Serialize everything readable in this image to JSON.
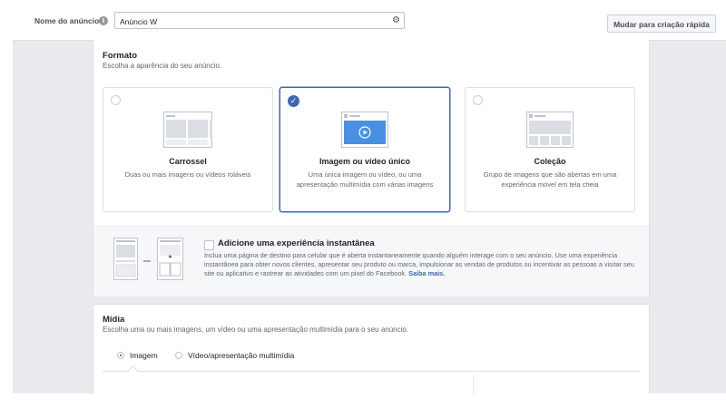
{
  "header": {
    "name_label": "Nome do anúncio",
    "name_value": "Anúncio W",
    "quick_create_label": "Mudar para criação rápida"
  },
  "format": {
    "title": "Formato",
    "subtitle": "Escolha a aparência do seu anúncio.",
    "options": [
      {
        "title": "Carrossel",
        "desc": "Duas ou mais imagens ou vídeos roláveis",
        "selected": false
      },
      {
        "title": "Imagem ou vídeo único",
        "desc": "Uma única imagem ou vídeo, ou uma apresentação multimídia com várias imagens",
        "selected": true
      },
      {
        "title": "Coleção",
        "desc": "Grupo de imagens que são abertas em uma experiência móvel em tela cheia",
        "selected": false
      }
    ],
    "instant": {
      "title": "Adicione uma experiência instantânea",
      "desc": "Inclua uma página de destino para celular que é aberta instantaneamente quando alguém interage com o seu anúncio. Use uma experiência instantânea para obter novos clientes, apresentar seu produto ou marca, impulsionar as vendas de produtos ou incentivar as pessoas a visitar seu site ou aplicativo e rastrear as atividades com um pixel do Facebook.",
      "link": "Saiba mais.",
      "checked": false
    }
  },
  "media": {
    "title": "Mídia",
    "subtitle": "Escolha uma ou mais imagens, um vídeo ou uma apresentação multimídia para o seu anúncio.",
    "options": [
      {
        "label": "Imagem",
        "selected": true
      },
      {
        "label": "Vídeo/apresentação multimídia",
        "selected": false
      }
    ]
  },
  "colors": {
    "accent": "#4267b2",
    "background": "#e9ebee",
    "border": "#dddfe2"
  }
}
